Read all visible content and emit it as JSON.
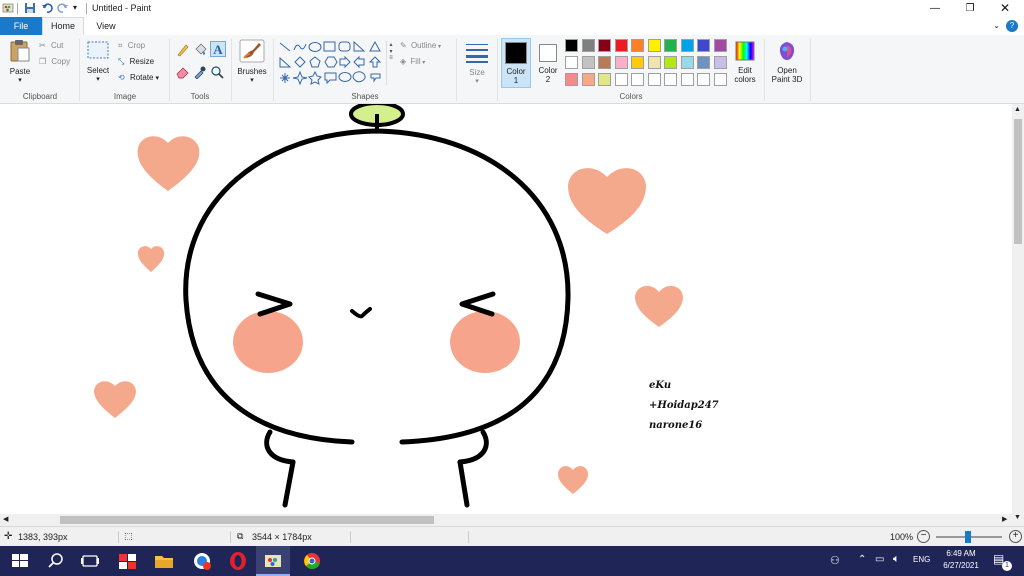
{
  "window": {
    "title": "Untitled - Paint"
  },
  "tabs": {
    "file": "File",
    "home": "Home",
    "view": "View"
  },
  "ribbon": {
    "clipboard": {
      "paste": "Paste",
      "cut": "Cut",
      "copy": "Copy",
      "label": "Clipboard"
    },
    "image": {
      "select": "Select",
      "crop": "Crop",
      "resize": "Resize",
      "rotate": "Rotate",
      "label": "Image"
    },
    "tools": {
      "label": "Tools"
    },
    "brushes": {
      "label": "Brushes"
    },
    "shapes": {
      "label": "Shapes",
      "outline": "Outline",
      "fill": "Fill"
    },
    "size": {
      "label": "Size"
    },
    "color1": {
      "label": "Color",
      "num": "1"
    },
    "color2": {
      "label": "Color",
      "num": "2"
    },
    "colors": {
      "label": "Colors",
      "edit": "Edit",
      "edit2": "colors",
      "row1": [
        "#000000",
        "#7f7f7f",
        "#880015",
        "#ed1c24",
        "#ff7f27",
        "#fff200",
        "#22b14c",
        "#00a2e8",
        "#3f48cc",
        "#a349a4"
      ],
      "row2": [
        "#ffffff",
        "#c3c3c3",
        "#b97a57",
        "#ffaec9",
        "#ffc90e",
        "#efe4b0",
        "#b5e61d",
        "#99d9ea",
        "#7092be",
        "#c8bfe7"
      ],
      "row3": [
        "#f08c8c",
        "#f5a987",
        "#e0e68c",
        "#ffffff",
        "#ffffff",
        "#ffffff",
        "#ffffff",
        "#ffffff",
        "#ffffff",
        "#ffffff"
      ]
    },
    "paint3d": {
      "line1": "Open",
      "line2": "Paint 3D"
    }
  },
  "canvas": {
    "credit1": "eKu",
    "credit2": "+Hoidap247",
    "credit3": "narone16",
    "heart_color": "#f5a98c",
    "blush_color": "#f6a58c",
    "sprout_color": "#d4ef8e"
  },
  "status": {
    "cursor": "1383, 393px",
    "size": "3544 × 1784px",
    "zoom": "100%"
  },
  "taskbar": {
    "lang": "ENG",
    "time": "6:49 AM",
    "date": "6/27/2021",
    "notif": "1"
  }
}
